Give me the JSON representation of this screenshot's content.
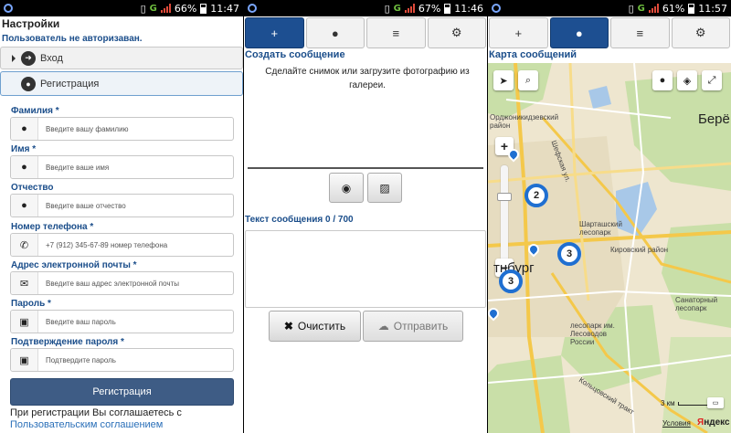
{
  "status_bars": [
    {
      "network": "G",
      "battery": "66%",
      "time": "11:47"
    },
    {
      "network": "G",
      "battery": "67%",
      "time": "11:46"
    },
    {
      "network": "G",
      "battery": "61%",
      "time": "11:57"
    }
  ],
  "settings": {
    "title": "Настройки",
    "auth_status": "Пользователь не авторизаван.",
    "login_label": "Вход",
    "register_section_label": "Регистрация",
    "fields": [
      {
        "label": "Фамилия *",
        "placeholder": "Введите вашу фамилию",
        "icon": "person-icon"
      },
      {
        "label": "Имя *",
        "placeholder": "Введите ваше имя",
        "icon": "person-icon"
      },
      {
        "label": "Отчество",
        "placeholder": "Введите ваше отчество",
        "icon": "person-icon"
      },
      {
        "label": "Номер телефона *",
        "placeholder": "+7 (912) 345-67-89 номер телефона",
        "icon": "phone-icon"
      },
      {
        "label": "Адрес электронной почты *",
        "placeholder": "Введите ваш адрес электронной почты",
        "icon": "envelope-icon"
      },
      {
        "label": "Пароль *",
        "placeholder": "Введите ваш пароль",
        "icon": "lock-icon"
      },
      {
        "label": "Подтверждение пароля *",
        "placeholder": "Подтвердите пароль",
        "icon": "lock-icon"
      }
    ],
    "register_button": "Регистрация",
    "agreement_text": "При регистрации Вы соглашаетесь с",
    "agreement_link": "Пользовательским соглашением"
  },
  "tabs": [
    {
      "icon": "plus-icon",
      "glyph": "+"
    },
    {
      "icon": "globe-icon",
      "glyph": "●"
    },
    {
      "icon": "list-icon",
      "glyph": "≡"
    },
    {
      "icon": "gear-icon",
      "glyph": "⚙"
    }
  ],
  "compose": {
    "title": "Создать сообщение",
    "hint": "Сделайте снимок или загрузите фотографию из галереи.",
    "text_label": "Текст сообщения 0 / 700",
    "clear_button": "Очистить",
    "send_button": "Отправить"
  },
  "map": {
    "title": "Карта сообщений",
    "labels": {
      "district_ordzh": "Орджоникидзевский район",
      "street_shef": "Шефская ул.",
      "park_shart": "Шарташский лесопарк",
      "district_kirov": "Кировский район",
      "city": "Екатеринбург",
      "city_visible": "тнбург",
      "sanatorium": "Санаторный лесопарк",
      "park_les": "лесопарк им. Лесоводов России",
      "tract": "Кольцовский тракт",
      "bere": "Берё"
    },
    "clusters": [
      "2",
      "3",
      "3"
    ],
    "scale": "3 км",
    "terms": "Условия",
    "logo_a": "Я",
    "logo_b": "ндекс"
  },
  "colors": {
    "accent": "#1d4f91",
    "label": "#1a4d8a",
    "cluster": "#1f6fd1"
  }
}
